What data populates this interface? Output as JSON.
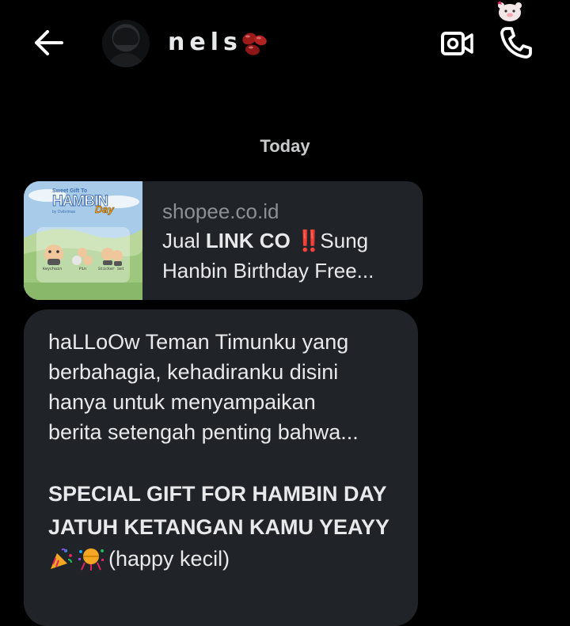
{
  "header": {
    "contact_name": "nels",
    "name_emoji_icon": "beans-icon",
    "back_icon": "arrow-left-icon",
    "video_icon": "video-camera-icon",
    "call_icon": "phone-icon",
    "sticker_icon": "pig-sticker-icon"
  },
  "date_separator": "Today",
  "link_card": {
    "domain": "shopee.co.id",
    "title_prefix": "Jual ",
    "title_bold": "LINK CO",
    "title_bang": "‼️",
    "title_rest": "Sung",
    "title_line2": "Hanbin Birthday Free...",
    "thumbnail": {
      "title_small": "Sweet Gift To",
      "title_big": "HAMBIN",
      "title_day": "Day",
      "byline": "by Ovibrimas",
      "labels": [
        "Keychain",
        "Pin",
        "Sticker Set"
      ]
    }
  },
  "message": {
    "lines": [
      "haLLoOw Teman Timunku yang",
      "berbahagia, kehadiranku disini",
      "hanya untuk menyampaikan",
      "berita setengah penting bahwa..."
    ],
    "bold_lines": [
      "SPECIAL GIFT FOR HAMBIN DAY",
      "JATUH KETANGAN KAMU YEAYY"
    ],
    "emoji_icons": [
      "party-popper-icon",
      "confetti-icon"
    ],
    "trailing_text": "(happy kecil)"
  },
  "colors": {
    "background": "#000000",
    "bubble": "#202327",
    "text": "#e7e9ea",
    "muted": "#8b9096",
    "accent_red": "#e0245e"
  }
}
